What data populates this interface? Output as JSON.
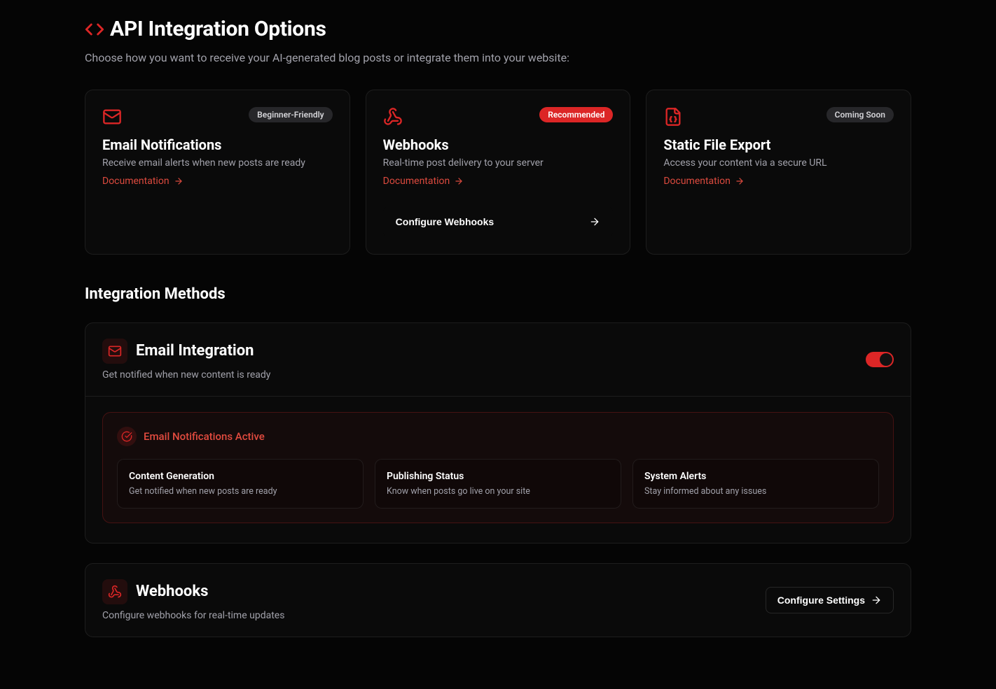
{
  "colors": {
    "accent": "#dc2626"
  },
  "page": {
    "title": "API Integration Options",
    "subtitle": "Choose how you want to receive your AI-generated blog posts or integrate them into your website:"
  },
  "cards": {
    "email": {
      "badge": "Beginner-Friendly",
      "title": "Email Notifications",
      "desc": "Receive email alerts when new posts are ready",
      "doc_label": "Documentation"
    },
    "webhooks": {
      "badge": "Recommended",
      "title": "Webhooks",
      "desc": "Real-time post delivery to your server",
      "doc_label": "Documentation",
      "configure_label": "Configure Webhooks"
    },
    "static": {
      "badge": "Coming Soon",
      "title": "Static File Export",
      "desc": "Access your content via a secure URL",
      "doc_label": "Documentation"
    }
  },
  "methods": {
    "heading": "Integration Methods",
    "email": {
      "title": "Email Integration",
      "subtitle": "Get notified when new content is ready",
      "active_label": "Email Notifications Active",
      "features": [
        {
          "title": "Content Generation",
          "desc": "Get notified when new posts are ready"
        },
        {
          "title": "Publishing Status",
          "desc": "Know when posts go live on your site"
        },
        {
          "title": "System Alerts",
          "desc": "Stay informed about any issues"
        }
      ]
    },
    "webhooks": {
      "title": "Webhooks",
      "subtitle": "Configure webhooks for real-time updates",
      "configure_label": "Configure Settings"
    }
  }
}
